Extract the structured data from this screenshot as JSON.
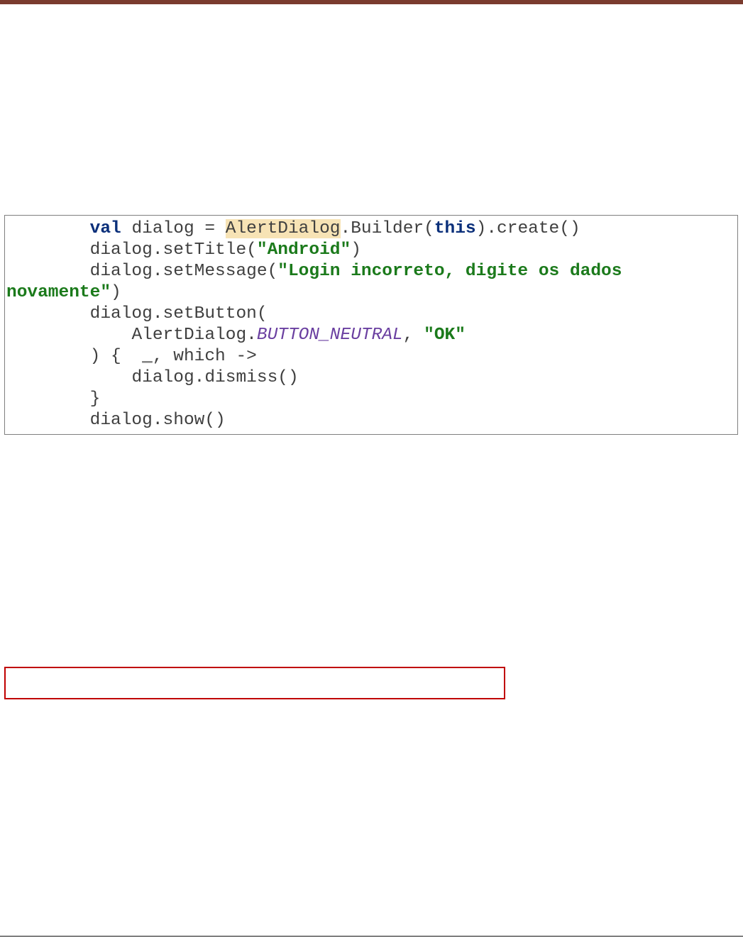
{
  "code": {
    "indent1": "        ",
    "indent2": "            ",
    "kw_val": "val",
    "sp": " ",
    "dialog_eq": "dialog = ",
    "alertdialog_hl": "AlertDialog",
    "builder_open": ".Builder(",
    "kw_this": "this",
    "create_tail": ").create()",
    "set_title_open": "dialog.setTitle(",
    "str_android": "\"Android\"",
    "close_paren": ")",
    "set_msg_open": "dialog.setMessage(",
    "str_msg1": "\"Login incorreto, digite os dados ",
    "str_msg2": "novamente\"",
    "set_button": "dialog.setButton(",
    "alertdialog_plain": "AlertDialog.",
    "button_neutral": "BUTTON_NEUTRAL",
    "comma_sp": ", ",
    "str_ok": "\"OK\"",
    "lambda_open": ") {  ",
    "underscore": "_",
    "which_arrow": ", which ->",
    "dismiss_line": "dialog.dismiss()",
    "brace_close": "}",
    "show_line": "dialog.show()"
  }
}
